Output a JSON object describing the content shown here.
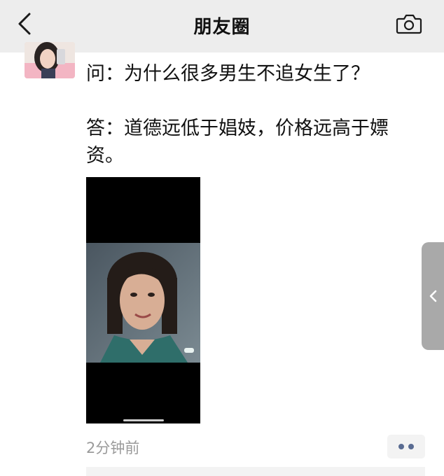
{
  "nav": {
    "title": "朋友圈",
    "back_icon": "chevron-left-icon",
    "camera_icon": "camera-icon"
  },
  "post": {
    "question": "问：为什么很多男生不追女生了？",
    "answer": "答：道德远低于娼妓，价格远高于嫖资。",
    "timestamp": "2分钟前",
    "more_icon": "more-dots-icon"
  },
  "colors": {
    "nav_background": "#ededed",
    "timestamp_text": "#9a9a9a",
    "link_blue": "#5a6c92",
    "side_handle": "#a9a9a9"
  }
}
